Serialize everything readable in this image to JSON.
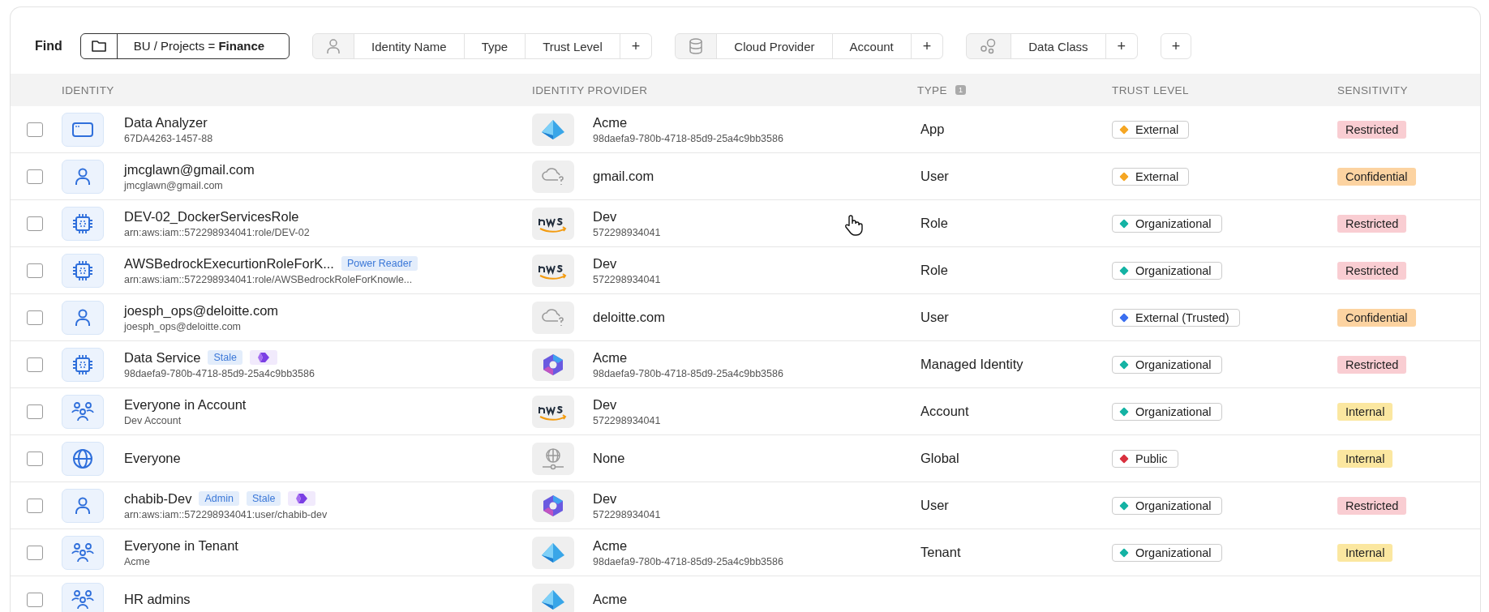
{
  "filter_bar": {
    "label": "Find",
    "scope": {
      "text": "BU / Projects = **Finance**"
    },
    "groups": [
      {
        "kind": "identity",
        "fields": [
          "Identity Name",
          "Type",
          "Trust Level"
        ],
        "add": "+"
      },
      {
        "kind": "cloud",
        "fields": [
          "Cloud Provider",
          "Account"
        ],
        "add": "+"
      },
      {
        "kind": "data",
        "fields": [
          "Data Class"
        ],
        "add": "+"
      }
    ],
    "add": "+"
  },
  "table": {
    "columns": [
      {
        "label": "IDENTITY"
      },
      {
        "label": "IDENTITY PROVIDER"
      },
      {
        "label": "TYPE",
        "count": "1"
      },
      {
        "label": "TRUST LEVEL"
      },
      {
        "label": "SENSITIVITY"
      }
    ],
    "rows": [
      {
        "checked": false,
        "kind": "app",
        "name": "Data Analyzer",
        "detail": "67DA4263-1457-88",
        "tags": [],
        "ai_badge": false,
        "provider": {
          "kind": "azure",
          "name": "Acme",
          "detail": "98daefa9-780b-4718-85d9-25a4c9bb3586"
        },
        "type": "App",
        "trust": {
          "label": "External",
          "color": "#f5a623"
        },
        "sensitivity": {
          "label": "Restricted",
          "color": "#f9cdd2"
        }
      },
      {
        "checked": false,
        "kind": "user",
        "name": "jmcglawn@gmail.com",
        "detail": "jmcglawn@gmail.com",
        "tags": [],
        "ai_badge": false,
        "provider": {
          "kind": "unknown",
          "name": "gmail.com"
        },
        "type": "User",
        "trust": {
          "label": "External",
          "color": "#f5a623"
        },
        "sensitivity": {
          "label": "Confidential",
          "color": "#fcd3a1"
        }
      },
      {
        "checked": false,
        "kind": "role",
        "name": "DEV-02_DockerServicesRole",
        "detail": "arn:aws:iam::572298934041:role/DEV-02",
        "tags": [],
        "ai_badge": false,
        "provider": {
          "kind": "aws",
          "name": "Dev",
          "detail": "572298934041"
        },
        "type": "Role",
        "trust": {
          "label": "Organizational",
          "color": "#14b3a4"
        },
        "sensitivity": {
          "label": "Restricted",
          "color": "#f9cdd2"
        }
      },
      {
        "checked": false,
        "kind": "role",
        "name": "AWSBedrockExecurtionRoleForK...",
        "detail": "arn:aws:iam::572298934041:role/AWSBedrockRoleForKnowle...",
        "tags": [
          "Power Reader"
        ],
        "ai_badge": false,
        "provider": {
          "kind": "aws",
          "name": "Dev",
          "detail": "572298934041"
        },
        "type": "Role",
        "trust": {
          "label": "Organizational",
          "color": "#14b3a4"
        },
        "sensitivity": {
          "label": "Restricted",
          "color": "#f9cdd2"
        }
      },
      {
        "checked": false,
        "kind": "user",
        "name": "joesph_ops@deloitte.com",
        "detail": "joesph_ops@deloitte.com",
        "tags": [],
        "ai_badge": false,
        "provider": {
          "kind": "unknown",
          "name": "deloitte.com"
        },
        "type": "User",
        "trust": {
          "label": "External (Trusted)",
          "color": "#3b6ff0"
        },
        "sensitivity": {
          "label": "Confidential",
          "color": "#fcd3a1"
        }
      },
      {
        "checked": false,
        "kind": "role",
        "name": "Data Service",
        "detail": "98daefa9-780b-4718-85d9-25a4c9bb3586",
        "tags": [
          "Stale"
        ],
        "ai_badge": true,
        "provider": {
          "kind": "ring",
          "name": "Acme",
          "detail": "98daefa9-780b-4718-85d9-25a4c9bb3586"
        },
        "type": "Managed Identity",
        "trust": {
          "label": "Organizational",
          "color": "#14b3a4"
        },
        "sensitivity": {
          "label": "Restricted",
          "color": "#f9cdd2"
        }
      },
      {
        "checked": false,
        "kind": "group",
        "name": "Everyone in Account",
        "detail": "Dev Account",
        "tags": [],
        "ai_badge": false,
        "provider": {
          "kind": "aws",
          "name": "Dev",
          "detail": "572298934041"
        },
        "type": "Account",
        "trust": {
          "label": "Organizational",
          "color": "#14b3a4"
        },
        "sensitivity": {
          "label": "Internal",
          "color": "#fbe7a0"
        }
      },
      {
        "checked": false,
        "kind": "globe",
        "name": "Everyone",
        "tags": [],
        "ai_badge": false,
        "provider": {
          "kind": "none",
          "name": "None"
        },
        "type": "Global",
        "trust": {
          "label": "Public",
          "color": "#d9303e"
        },
        "sensitivity": {
          "label": "Internal",
          "color": "#fbe7a0"
        }
      },
      {
        "checked": false,
        "kind": "user",
        "name": "chabib-Dev",
        "detail": "arn:aws:iam::572298934041:user/chabib-dev",
        "tags": [
          "Admin",
          "Stale"
        ],
        "ai_badge": true,
        "provider": {
          "kind": "ring",
          "name": "Dev",
          "detail": "572298934041"
        },
        "type": "User",
        "trust": {
          "label": "Organizational",
          "color": "#14b3a4"
        },
        "sensitivity": {
          "label": "Restricted",
          "color": "#f9cdd2"
        }
      },
      {
        "checked": false,
        "kind": "group",
        "name": "Everyone in Tenant",
        "detail": "Acme",
        "tags": [],
        "ai_badge": false,
        "provider": {
          "kind": "azure",
          "name": "Acme",
          "detail": "98daefa9-780b-4718-85d9-25a4c9bb3586"
        },
        "type": "Tenant",
        "trust": {
          "label": "Organizational",
          "color": "#14b3a4"
        },
        "sensitivity": {
          "label": "Internal",
          "color": "#fbe7a0"
        }
      },
      {
        "checked": false,
        "kind": "group",
        "name": "HR admins",
        "tags": [],
        "ai_badge": false,
        "provider": {
          "kind": "azure",
          "name": "Acme"
        }
      }
    ]
  }
}
